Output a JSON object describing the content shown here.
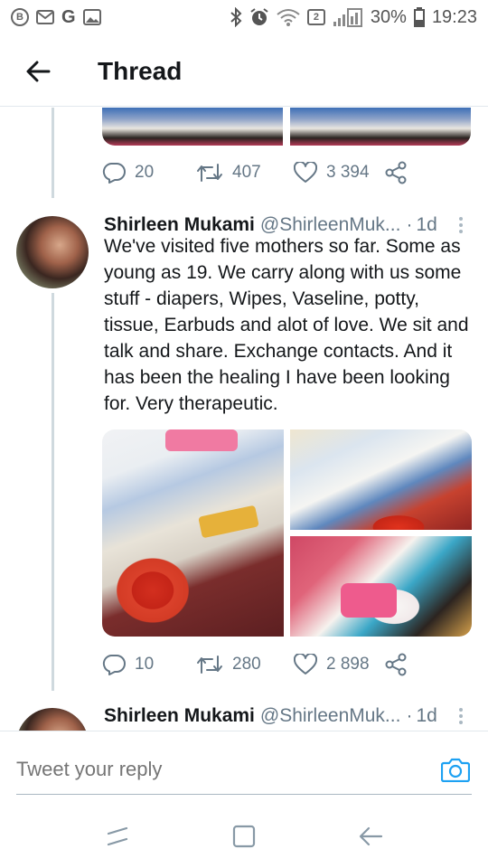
{
  "status_bar": {
    "left_icons": [
      "bitcoin-badge",
      "gmail-icon",
      "google-icon",
      "gallery-icon"
    ],
    "right_icons": [
      "bluetooth-icon",
      "alarm-icon",
      "wifi-icon",
      "signal-icon"
    ],
    "wifi_badge": "2",
    "battery": "30%",
    "time": "19:23"
  },
  "header": {
    "title": "Thread",
    "back_icon": "arrow-left-icon"
  },
  "previous_tweet": {
    "actions": {
      "reply_count": "20",
      "retweet_count": "407",
      "like_count": "3 394"
    }
  },
  "tweet": {
    "name": "Shirleen Mukami",
    "handle": "@ShirleenMuk...",
    "dot": "·",
    "time": "1d",
    "text": "We've visited five mothers so far. Some as young as 19. We carry along with us some stuff - diapers, Wipes, Vaseline, potty, tissue, Earbuds and alot of love. We sit and talk and share. Exchange contacts. And it has been the healing I have been looking for. Very therapeutic.",
    "actions": {
      "reply_count": "10",
      "retweet_count": "280",
      "like_count": "2 898"
    }
  },
  "next_tweet": {
    "name": "Shirleen Mukami",
    "handle": "@ShirleenMuk...",
    "dot": "·",
    "time": "1d"
  },
  "reply": {
    "placeholder": "Tweet your reply",
    "camera_icon": "camera-icon"
  },
  "colors": {
    "accent": "#1da1f2",
    "text_secondary": "#657786",
    "divider": "#e1e8ed"
  }
}
